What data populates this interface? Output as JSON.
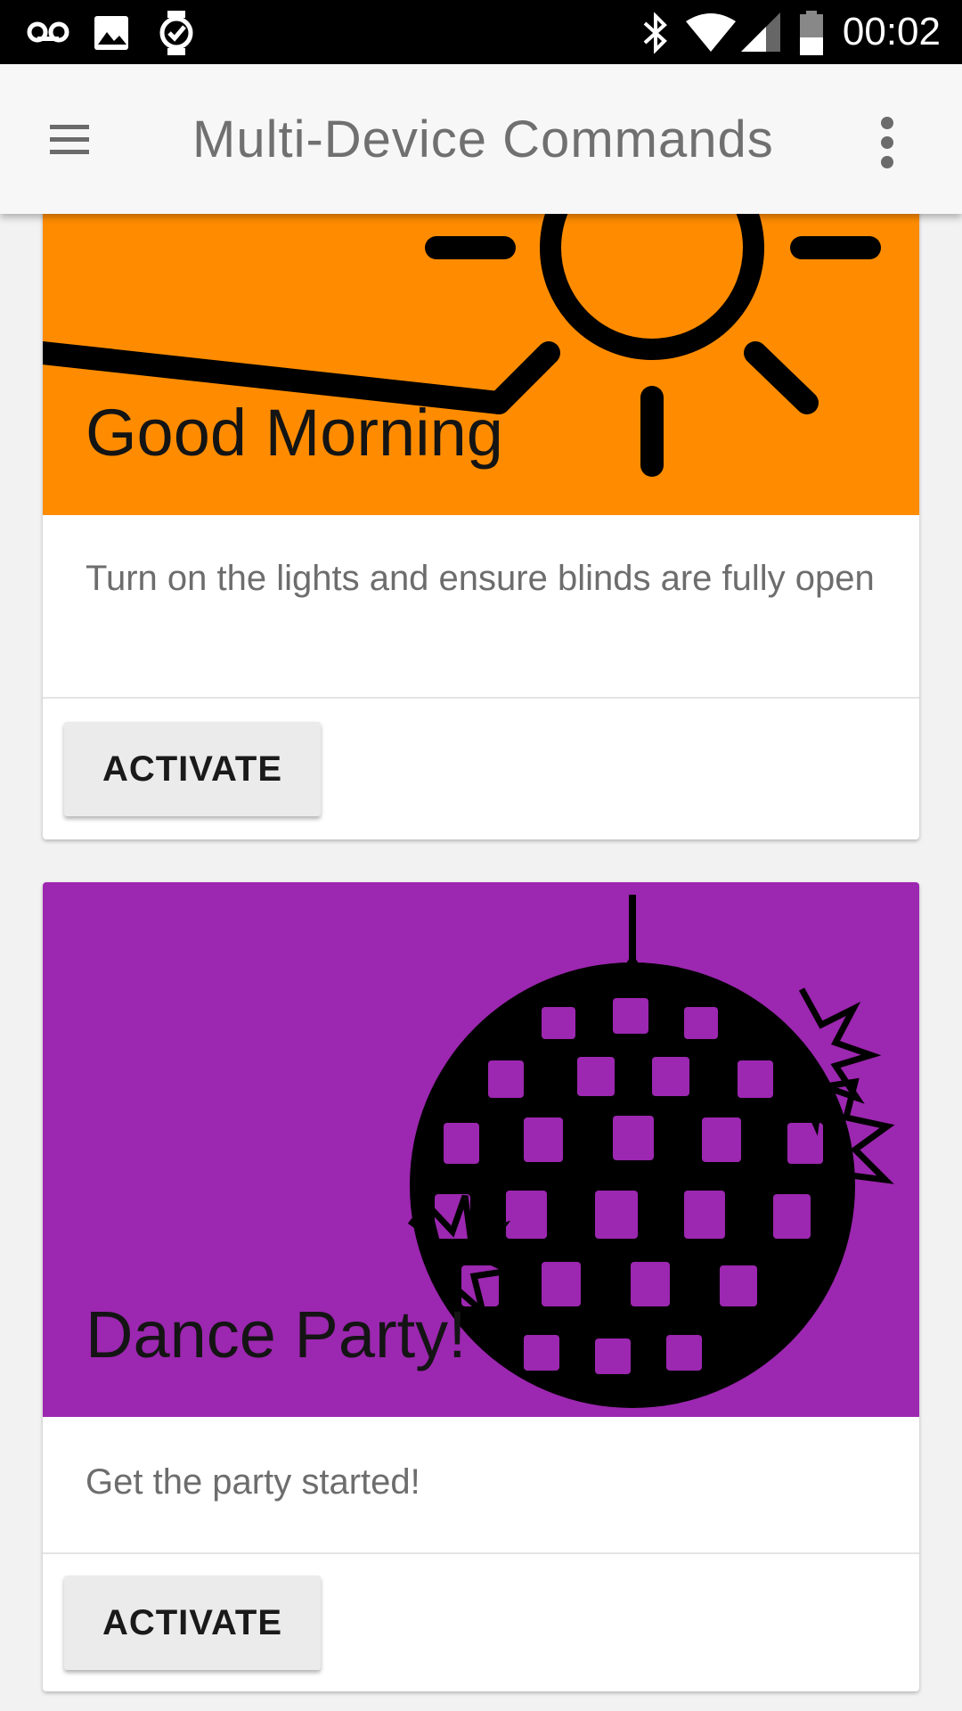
{
  "status_bar": {
    "time": "00:02",
    "icons": [
      "voicemail-icon",
      "image-icon",
      "watch-icon",
      "bluetooth-icon",
      "wifi-icon",
      "signal-icon",
      "battery-icon"
    ]
  },
  "app_bar": {
    "title": "Multi-Device Commands",
    "menu_icon": "hamburger-menu-icon",
    "overflow_icon": "more-vert-icon"
  },
  "cards": [
    {
      "title": "Good Morning",
      "description": "Turn on the lights and ensure blinds are fully open",
      "action_label": "ACTIVATE",
      "media_color": "#FF8C00",
      "illustration": "sun-icon"
    },
    {
      "title": "Dance Party!",
      "description": "Get the party started!",
      "action_label": "ACTIVATE",
      "media_color": "#9C27B0",
      "illustration": "disco-ball-icon"
    }
  ]
}
